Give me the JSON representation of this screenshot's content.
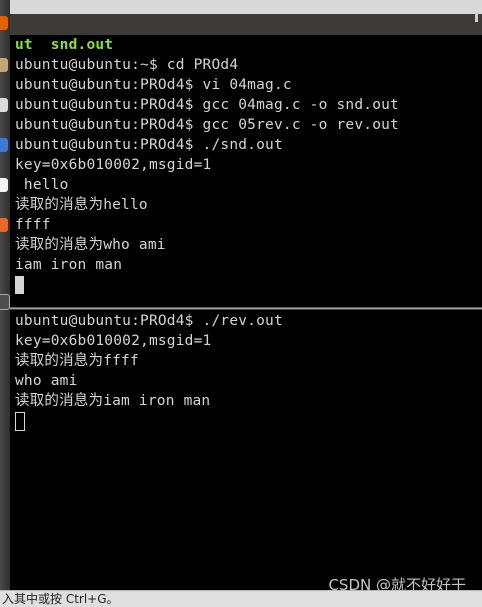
{
  "colors": {
    "terminal_bg": "#000000",
    "terminal_fg": "#d3d7cf",
    "bold_green": "#8ae234",
    "status_bg": "#dfdfdf"
  },
  "launcher": {
    "icons": [
      "firefox-icon",
      "files-icon",
      "software-center-icon",
      "settings-icon",
      "libreoffice-icon",
      "impress-icon",
      "terminal-icon"
    ]
  },
  "top_pane": {
    "lines": [
      "ut  snd.out",
      "ubuntu@ubuntu:~$ cd PROd4",
      "ubuntu@ubuntu:PROd4$ vi 04mag.c",
      "ubuntu@ubuntu:PROd4$ gcc 04mag.c -o snd.out",
      "ubuntu@ubuntu:PROd4$ gcc 05rev.c -o rev.out",
      "ubuntu@ubuntu:PROd4$ ./snd.out",
      "key=0x6b010002,msgid=1",
      " hello",
      "读取的消息为hello",
      "ffff",
      "读取的消息为who ami",
      "iam iron man"
    ]
  },
  "bottom_pane": {
    "lines": [
      "ubuntu@ubuntu:PROd4$ ./rev.out",
      "key=0x6b010002,msgid=1",
      "读取的消息为ffff",
      "who ami",
      "读取的消息为iam iron man"
    ]
  },
  "status_bar": {
    "text": "入其中或按 Ctrl+G。"
  },
  "watermark": "CSDN @就不好好干"
}
